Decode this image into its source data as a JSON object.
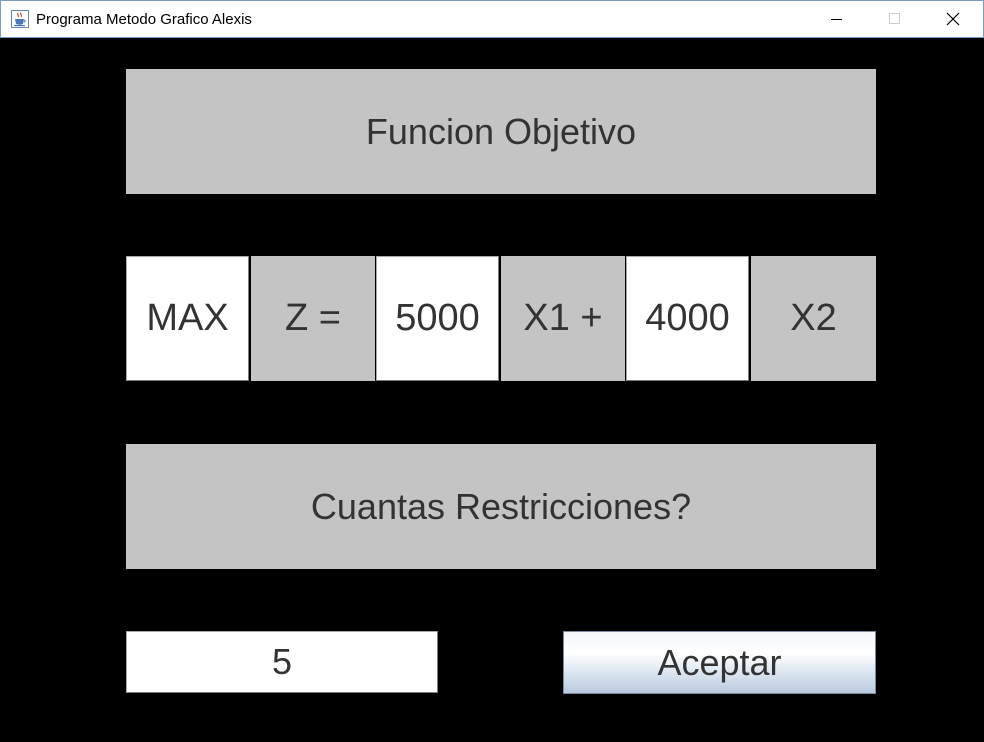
{
  "window": {
    "title": "Programa Metodo Grafico Alexis",
    "app_icon": "java-coffee-cup-icon",
    "controls": {
      "minimize_icon": "minimize-icon",
      "maximize_icon": "maximize-icon",
      "close_icon": "close-icon"
    }
  },
  "objective": {
    "header": "Funcion Objetivo",
    "mode": "MAX",
    "z_label": "Z =",
    "x1_coefficient": "5000",
    "x1_label": "X1 +",
    "x2_coefficient": "4000",
    "x2_label": "X2"
  },
  "constraints": {
    "question": "Cuantas Restricciones?",
    "count_value": "5",
    "accept_label": "Aceptar"
  },
  "colors": {
    "background": "#000000",
    "panel": "#c4c4c4",
    "field": "#ffffff",
    "text": "#333333"
  }
}
